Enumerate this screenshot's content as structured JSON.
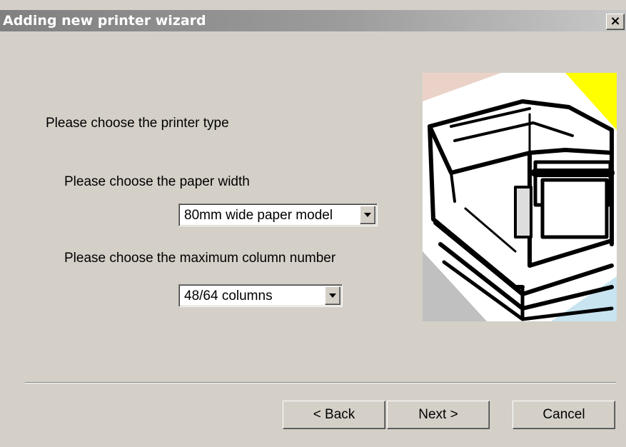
{
  "window": {
    "title": "Adding new printer wizard",
    "close_label": "×"
  },
  "content": {
    "printer_type_label": "Please choose the printer type",
    "paper_width_label": "Please choose the paper width",
    "paper_width_select": {
      "value": "80mm wide paper model"
    },
    "max_columns_label": "Please choose the maximum column number",
    "max_columns_select": {
      "value": "48/64 columns"
    },
    "illustration": "printer-illustration"
  },
  "buttons": {
    "back": "< Back",
    "next": "Next >",
    "cancel": "Cancel"
  },
  "colors": {
    "window_bg": "#d4d0c8",
    "title_gradient_start": "#808080",
    "title_gradient_end": "#c8c8c8"
  }
}
